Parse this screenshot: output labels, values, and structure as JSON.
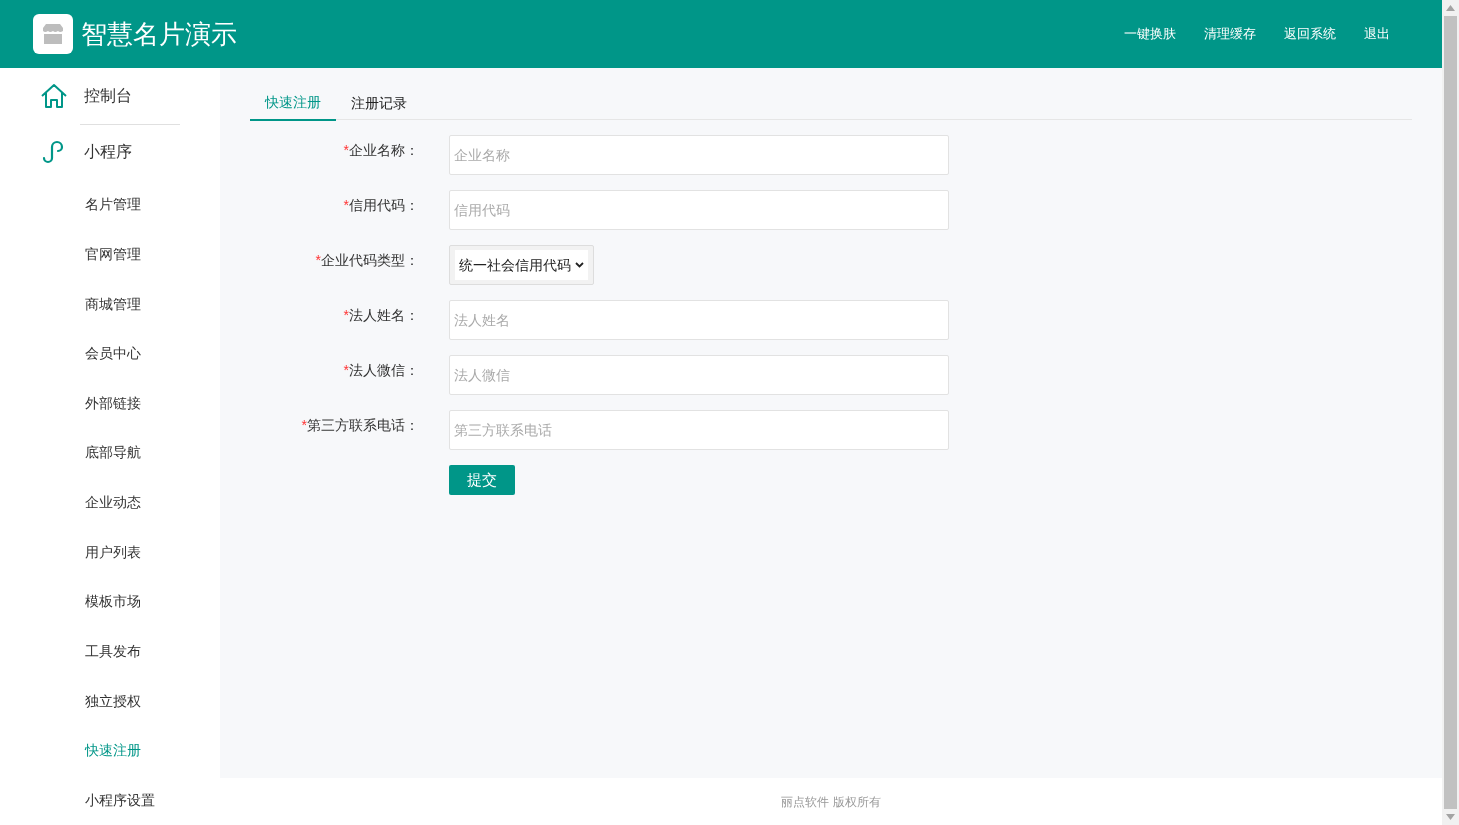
{
  "header": {
    "title": "智慧名片演示",
    "links": [
      "一键换肤",
      "清理缓存",
      "返回系统",
      "退出"
    ]
  },
  "sidebar": {
    "sections": [
      {
        "kind": "home",
        "label": "控制台"
      },
      {
        "kind": "link",
        "label": "小程序",
        "children": [
          {
            "label": "名片管理",
            "selected": false
          },
          {
            "label": "官网管理",
            "selected": false
          },
          {
            "label": "商城管理",
            "selected": false
          },
          {
            "label": "会员中心",
            "selected": false
          },
          {
            "label": "外部链接",
            "selected": false
          },
          {
            "label": "底部导航",
            "selected": false
          },
          {
            "label": "企业动态",
            "selected": false
          },
          {
            "label": "用户列表",
            "selected": false
          },
          {
            "label": "模板市场",
            "selected": false
          },
          {
            "label": "工具发布",
            "selected": false
          },
          {
            "label": "独立授权",
            "selected": false
          },
          {
            "label": "快速注册",
            "selected": true
          },
          {
            "label": "小程序设置",
            "selected": false
          }
        ]
      }
    ]
  },
  "tabs": [
    {
      "label": "快速注册",
      "selected": true
    },
    {
      "label": "注册记录",
      "selected": false
    }
  ],
  "form": {
    "fields": [
      {
        "kind": "text",
        "required_mark": "*",
        "label": "企业名称：",
        "placeholder": "企业名称"
      },
      {
        "kind": "text",
        "required_mark": "*",
        "label": "信用代码：",
        "placeholder": "信用代码"
      },
      {
        "kind": "select",
        "required_mark": "*",
        "label": "企业代码类型：",
        "value": "统一社会信用代码"
      },
      {
        "kind": "text",
        "required_mark": "*",
        "label": "法人姓名：",
        "placeholder": "法人姓名"
      },
      {
        "kind": "text",
        "required_mark": "*",
        "label": "法人微信：",
        "placeholder": "法人微信"
      },
      {
        "kind": "text",
        "required_mark": "*",
        "label": "第三方联系电话：",
        "placeholder": "第三方联系电话"
      }
    ],
    "submit": "提交"
  },
  "footer": "丽点软件 版权所有"
}
